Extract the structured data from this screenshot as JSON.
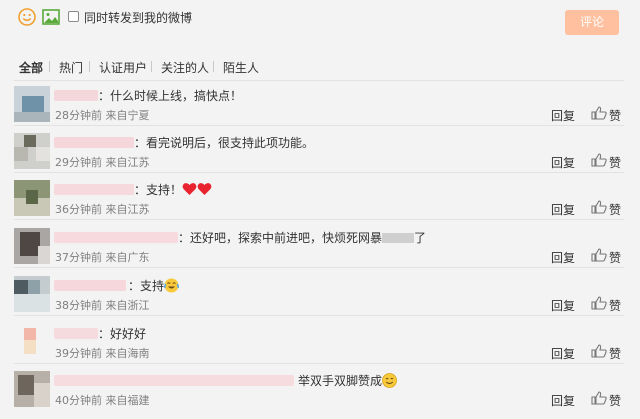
{
  "toolbar": {
    "emoji_icon": "smile-icon",
    "image_icon": "image-icon",
    "repost_label": "同时转发到我的微博",
    "repost_checked": false,
    "submit_label": "评论",
    "submit_color": "#ffc09f"
  },
  "tabs": [
    {
      "label": "全部",
      "active": true
    },
    {
      "label": "热门",
      "active": false
    },
    {
      "label": "认证用户",
      "active": false
    },
    {
      "label": "关注的人",
      "active": false
    },
    {
      "label": "陌生人",
      "active": false
    }
  ],
  "comments": [
    {
      "text": "：什么时候上线，搞快点！",
      "meta": "28分钟前 来自宁夏",
      "reply": "回复",
      "like": "赞"
    },
    {
      "text": "：看完说明后，很支持此项功能。",
      "meta": "29分钟前 来自江苏",
      "reply": "回复",
      "like": "赞"
    },
    {
      "text": "：支持！",
      "meta": "36分钟前 来自江苏",
      "reply": "回复",
      "like": "赞"
    },
    {
      "text": "：还好吧，探索中前进吧，快烦死网暴",
      "text_after": "了",
      "meta": "37分钟前 来自广东",
      "reply": "回复",
      "like": "赞"
    },
    {
      "text": "：支持",
      "meta": "38分钟前 来自浙江",
      "reply": "回复",
      "like": "赞"
    },
    {
      "text": "：好好好",
      "meta": "39分钟前 来自海南",
      "reply": "回复",
      "like": "赞"
    },
    {
      "text": "举双手双脚赞成",
      "meta": "40分钟前 来自福建",
      "reply": "回复",
      "like": "赞"
    }
  ]
}
